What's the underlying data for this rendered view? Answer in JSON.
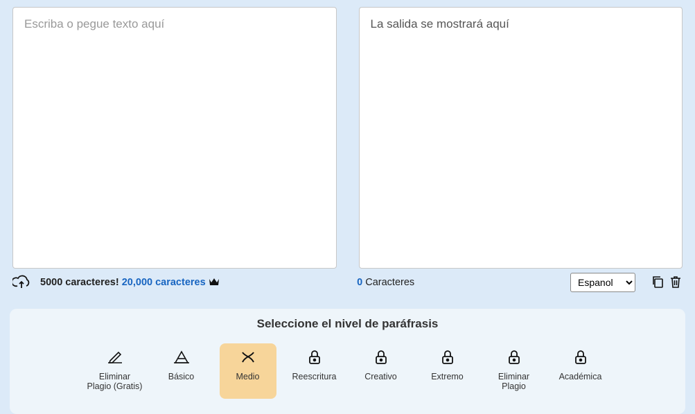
{
  "input": {
    "placeholder": "Escriba o pegue texto aquí",
    "value": ""
  },
  "output": {
    "placeholder": "La salida se mostrará aquí"
  },
  "limits": {
    "free_text": "5000 caracteres!",
    "upgrade_text": "20,000 caracteres"
  },
  "counter": {
    "value": "0",
    "label": "Caracteres"
  },
  "language": {
    "selected": "Espanol",
    "options": [
      "Espanol"
    ]
  },
  "levels_title": "Seleccione el nivel de paráfrasis",
  "levels": [
    {
      "id": "eliminar-plagio-gratis",
      "label": "Eliminar Plagio (Gratis)",
      "icon": "pen",
      "locked": false,
      "selected": false
    },
    {
      "id": "basico",
      "label": "Básico",
      "icon": "basic",
      "locked": false,
      "selected": false
    },
    {
      "id": "medio",
      "label": "Medio",
      "icon": "brush",
      "locked": false,
      "selected": true
    },
    {
      "id": "reescritura",
      "label": "Reescritura",
      "icon": "lock",
      "locked": true,
      "selected": false
    },
    {
      "id": "creativo",
      "label": "Creativo",
      "icon": "lock",
      "locked": true,
      "selected": false
    },
    {
      "id": "extremo",
      "label": "Extremo",
      "icon": "lock",
      "locked": true,
      "selected": false
    },
    {
      "id": "eliminar-plagio",
      "label": "Eliminar Plagio",
      "icon": "lock",
      "locked": true,
      "selected": false
    },
    {
      "id": "academica",
      "label": "Académica",
      "icon": "lock",
      "locked": true,
      "selected": false
    }
  ],
  "colors": {
    "page_bg": "#dceaf8",
    "panel_bg": "#eef5fa",
    "selected_level_bg": "#f7d59a",
    "link": "#1865c1"
  }
}
